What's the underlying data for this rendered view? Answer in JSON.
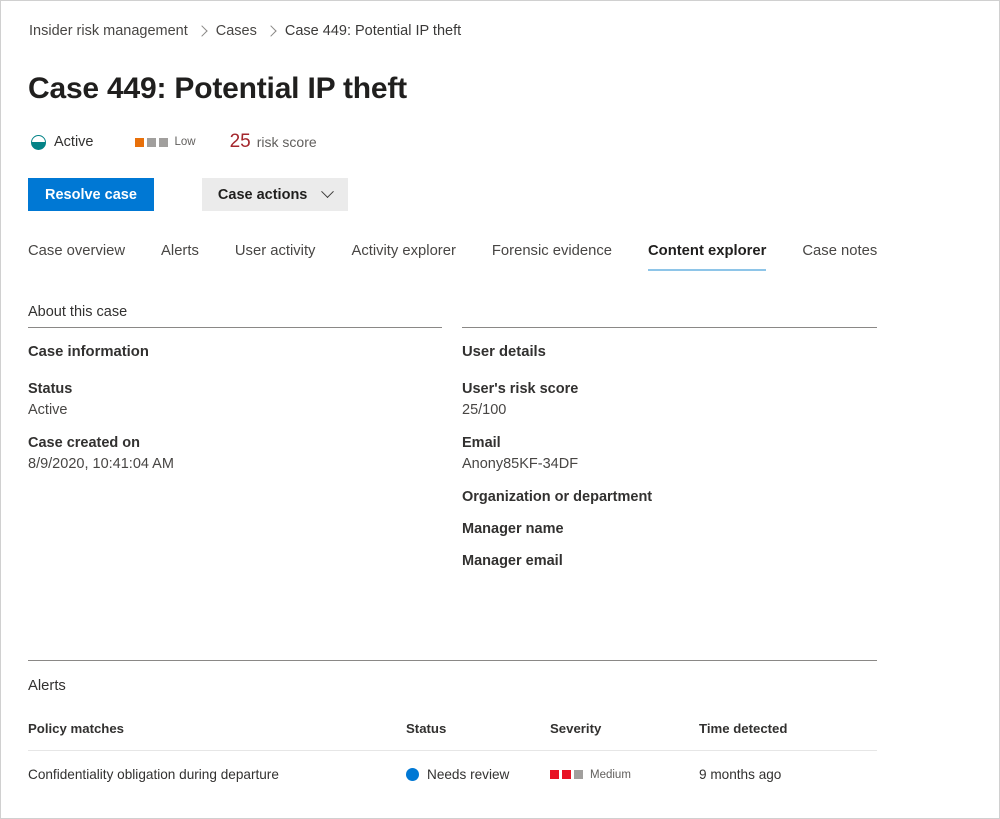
{
  "breadcrumb": {
    "items": [
      {
        "label": "Insider risk management"
      },
      {
        "label": "Cases"
      },
      {
        "label": "Case 449: Potential IP theft"
      }
    ]
  },
  "page_title": "Case 449: Potential IP theft",
  "status_strip": {
    "state": {
      "icon": "half-filled-circle-icon",
      "label": "Active",
      "color": "#038387"
    },
    "severity": {
      "label": "Low",
      "filled": 1,
      "total": 3,
      "fill_color": "#e8700a",
      "empty_color": "#a19f9d"
    },
    "risk_score": {
      "value": "25",
      "label": "risk score",
      "color": "#a4262c"
    }
  },
  "toolbar": {
    "resolve_label": "Resolve case",
    "actions_label": "Case actions",
    "primary_color": "#0078d4",
    "secondary_color": "#ebebeb"
  },
  "tabs": {
    "items": [
      {
        "label": "Case overview",
        "selected": false
      },
      {
        "label": "Alerts",
        "selected": false
      },
      {
        "label": "User activity",
        "selected": false
      },
      {
        "label": "Activity explorer",
        "selected": false
      },
      {
        "label": "Forensic evidence",
        "selected": false
      },
      {
        "label": "Content explorer",
        "selected": true
      },
      {
        "label": "Case notes",
        "selected": false
      }
    ],
    "selected_underline_color": "#8ec5e8"
  },
  "about": {
    "heading": "About this case",
    "left": {
      "title": "Case information",
      "fields": [
        {
          "label": "Status",
          "value": "Active"
        },
        {
          "label": "Case created on",
          "value": "8/9/2020, 10:41:04 AM"
        }
      ]
    },
    "right": {
      "title": "User details",
      "fields": [
        {
          "label": "User's risk score",
          "value": "25/100"
        },
        {
          "label": "Email",
          "value": "Anony85KF-34DF"
        },
        {
          "label": "Organization or department",
          "value": ""
        },
        {
          "label": "Manager name",
          "value": ""
        },
        {
          "label": "Manager email",
          "value": ""
        }
      ]
    }
  },
  "alerts": {
    "heading": "Alerts",
    "columns": [
      "Policy matches",
      "Status",
      "Severity",
      "Time detected"
    ],
    "rows": [
      {
        "policy": "Confidentiality obligation during departure",
        "status": "Needs review",
        "status_color": "#0078d4",
        "severity": "Medium",
        "severity_filled": 2,
        "severity_total": 3,
        "severity_fill_color": "#e81123",
        "severity_empty_color": "#a19f9d",
        "time": "9 months ago"
      }
    ]
  }
}
